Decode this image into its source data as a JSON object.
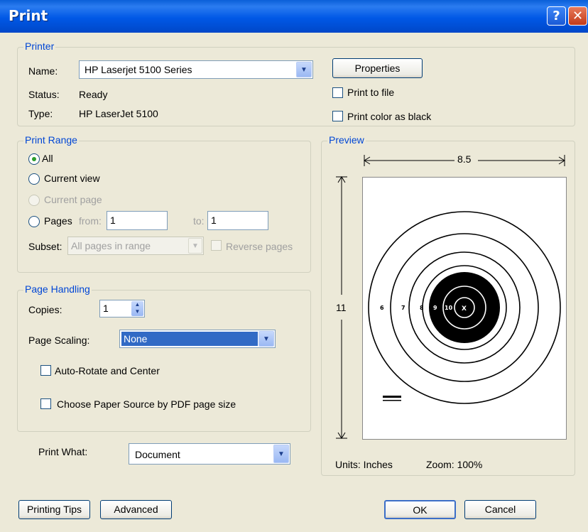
{
  "window": {
    "title": "Print",
    "help_icon": "question-mark-icon",
    "close_icon": "close-x-icon"
  },
  "printer": {
    "legend": "Printer",
    "name_label": "Name:",
    "name_value": "HP Laserjet 5100 Series",
    "status_label": "Status:",
    "status_value": "Ready",
    "type_label": "Type:",
    "type_value": "HP LaserJet 5100",
    "properties_label": "Properties",
    "print_to_file_label": "Print to file",
    "print_to_file_checked": false,
    "print_color_as_black_label": "Print color as black",
    "print_color_as_black_checked": false
  },
  "print_range": {
    "legend": "Print Range",
    "all_label": "All",
    "current_view_label": "Current view",
    "current_page_label": "Current page",
    "pages_label": "Pages",
    "from_label": "from:",
    "from_value": "1",
    "to_label": "to:",
    "to_value": "1",
    "subset_label": "Subset:",
    "subset_value": "All pages in range",
    "reverse_pages_label": "Reverse pages",
    "selected": "All"
  },
  "page_handling": {
    "legend": "Page Handling",
    "copies_label": "Copies:",
    "copies_value": "1",
    "page_scaling_label": "Page Scaling:",
    "page_scaling_value": "None",
    "auto_rotate_label": "Auto-Rotate and Center",
    "auto_rotate_checked": false,
    "paper_source_label": "Choose Paper Source by PDF page size",
    "paper_source_checked": false
  },
  "print_what": {
    "label": "Print What:",
    "value": "Document"
  },
  "preview": {
    "legend": "Preview",
    "width_label": "8.5",
    "height_label": "11",
    "units_text": "Units: Inches",
    "zoom_text": "Zoom: 100%",
    "ring_labels": [
      "6",
      "7",
      "8",
      "9",
      "10",
      "X"
    ]
  },
  "buttons": {
    "printing_tips": "Printing Tips",
    "advanced": "Advanced",
    "ok": "OK",
    "cancel": "Cancel"
  },
  "colors": {
    "titlebar": "#0058e6",
    "legend_text": "#0046d5",
    "selection": "#316ac5",
    "dialog_bg": "#ece9d8"
  }
}
